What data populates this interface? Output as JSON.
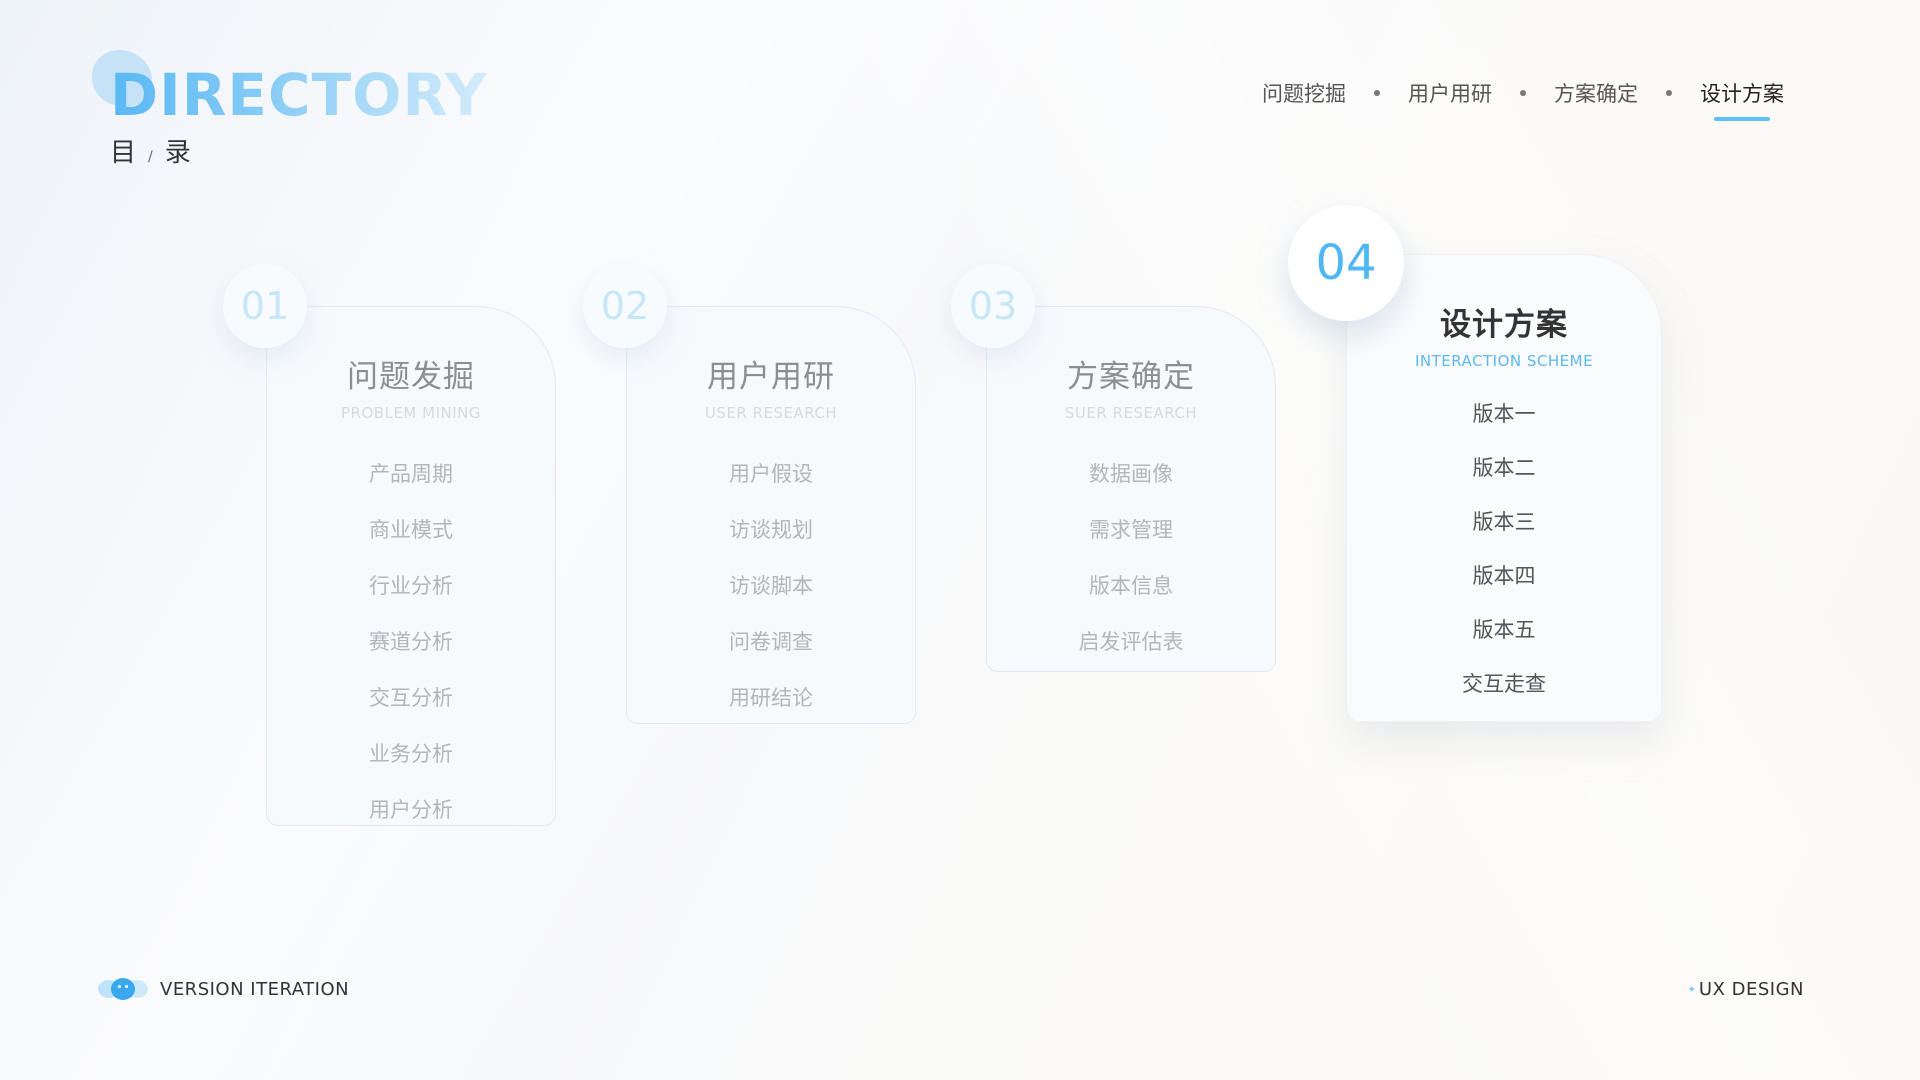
{
  "header": {
    "title_en": "DIRECTORY",
    "title_cn_left": "目",
    "title_cn_sep": "/",
    "title_cn_right": "录"
  },
  "nav": {
    "items": [
      {
        "label": "问题挖掘"
      },
      {
        "label": "用户用研"
      },
      {
        "label": "方案确定"
      },
      {
        "label": "设计方案"
      }
    ],
    "active_index": 3
  },
  "cards": [
    {
      "num": "01",
      "title": "问题发掘",
      "subtitle": "PROBLEM MINING",
      "items": [
        "产品周期",
        "商业模式",
        "行业分析",
        "赛道分析",
        "交互分析",
        "业务分析",
        "用户分析"
      ]
    },
    {
      "num": "02",
      "title": "用户用研",
      "subtitle": "USER RESEARCH",
      "items": [
        "用户假设",
        "访谈规划",
        "访谈脚本",
        "问卷调查",
        "用研结论"
      ]
    },
    {
      "num": "03",
      "title": "方案确定",
      "subtitle": "SUER RESEARCH",
      "items": [
        "数据画像",
        "需求管理",
        "版本信息",
        "启发评估表"
      ]
    },
    {
      "num": "04",
      "title": "设计方案",
      "subtitle": "INTERACTION SCHEME",
      "items": [
        "版本一",
        "版本二",
        "版本三",
        "版本四",
        "版本五",
        "交互走查"
      ]
    }
  ],
  "footer": {
    "left_label": "VERSION ITERATION",
    "right_label": "UX DESIGN"
  },
  "colors": {
    "accent": "#4fb7f1",
    "text_dark": "#333333",
    "text_muted": "#b2b6bb"
  },
  "icons": {
    "brand_logo": "cat-cloud-logo-icon",
    "sparkle": "sparkle-icon"
  }
}
